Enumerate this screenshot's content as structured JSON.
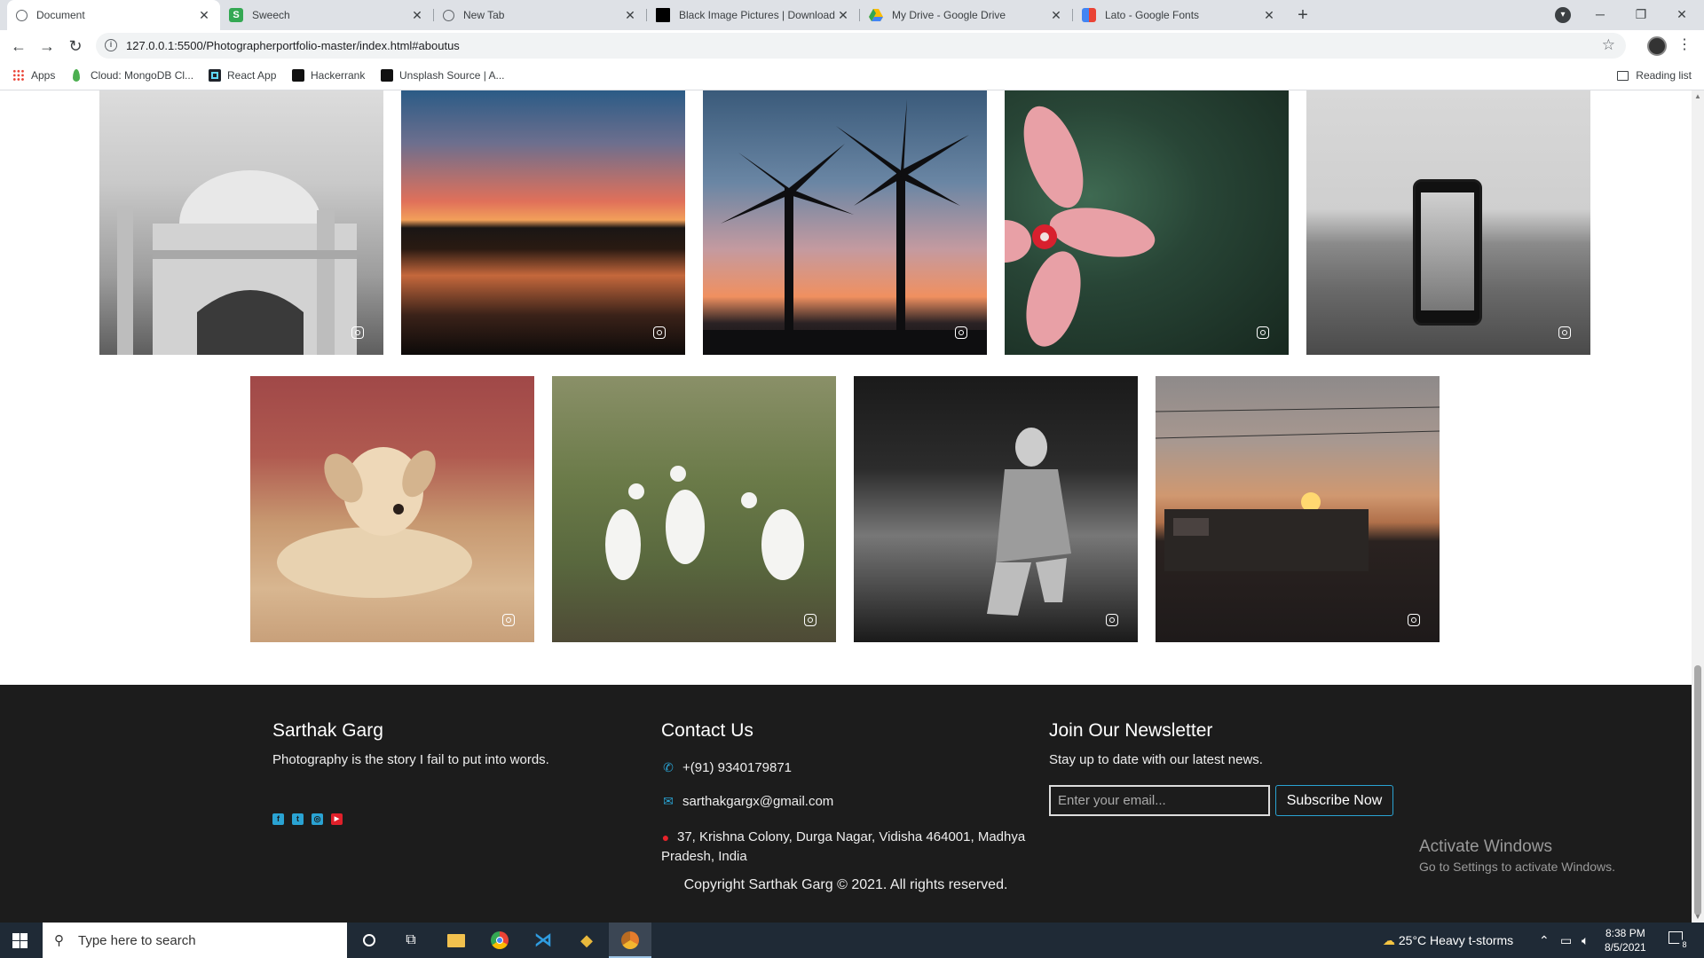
{
  "browser": {
    "tabs": [
      {
        "title": "Document",
        "active": true,
        "favicon": "globe-icon"
      },
      {
        "title": "Sweech",
        "active": false,
        "favicon": "sweech-icon"
      },
      {
        "title": "New Tab",
        "active": false,
        "favicon": "globe-icon"
      },
      {
        "title": "Black Image Pictures | Download",
        "active": false,
        "favicon": "unsplash-icon"
      },
      {
        "title": "My Drive - Google Drive",
        "active": false,
        "favicon": "drive-icon"
      },
      {
        "title": "Lato - Google Fonts",
        "active": false,
        "favicon": "google-fonts-icon"
      }
    ],
    "url": "127.0.0.1:5500/Photographerportfolio-master/index.html#aboutus",
    "bookmarks": [
      {
        "label": "Apps",
        "icon": "apps-grid-icon"
      },
      {
        "label": "Cloud: MongoDB Cl...",
        "icon": "mongodb-icon"
      },
      {
        "label": "React App",
        "icon": "react-icon"
      },
      {
        "label": "Hackerrank",
        "icon": "hackerrank-icon"
      },
      {
        "label": "Unsplash Source | A...",
        "icon": "unsplash-icon"
      }
    ],
    "reading_list": "Reading list"
  },
  "gallery": {
    "row1": [
      {
        "subject": "taj-mahal-bw"
      },
      {
        "subject": "sunset-lake"
      },
      {
        "subject": "palm-trees-sunset"
      },
      {
        "subject": "pink-flower"
      },
      {
        "subject": "phone-lake-bw"
      }
    ],
    "row2": [
      {
        "subject": "puppy"
      },
      {
        "subject": "egrets"
      },
      {
        "subject": "old-man-walking"
      },
      {
        "subject": "train-sunrise"
      }
    ]
  },
  "footer": {
    "about": {
      "name": "Sarthak Garg",
      "tagline": "Photography is the story I fail to put into words.",
      "socials": [
        "facebook-icon",
        "twitter-icon",
        "instagram-icon",
        "youtube-icon"
      ]
    },
    "contact": {
      "heading": "Contact Us",
      "phone": "+(91) 9340179871",
      "email": "sarthakgargx@gmail.com",
      "address_line1": "37, Krishna Colony, Durga Nagar, Vidisha 464001, Madhya",
      "address_line2": "Pradesh, India"
    },
    "newsletter": {
      "heading": "Join Our Newsletter",
      "text": "Stay up to date with our latest news.",
      "placeholder": "Enter your email...",
      "button": "Subscribe Now"
    },
    "copyright": "Copyright Sarthak Garg © 2021. All rights reserved.",
    "watermark": {
      "line1": "Activate Windows",
      "line2": "Go to Settings to activate Windows."
    }
  },
  "taskbar": {
    "search_placeholder": "Type here to search",
    "weather": "25°C  Heavy t-storms",
    "time": "8:38 PM",
    "date": "8/5/2021",
    "notifications": "8"
  },
  "colors": {
    "footer_bg": "#1c1c1c",
    "accent_blue": "#2aa3d3",
    "youtube_red": "#e0202a",
    "pin_red": "#e8232a"
  }
}
